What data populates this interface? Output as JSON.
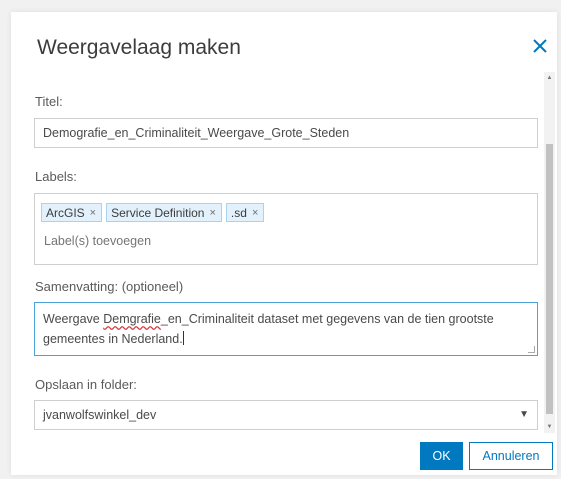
{
  "dialog": {
    "title": "Weergavelaag maken",
    "close_icon": "close-icon"
  },
  "fields": {
    "title_label": "Titel:",
    "title_value": "Demografie_en_Criminaliteit_Weergave_Grote_Steden",
    "labels_label": "Labels:",
    "tags": [
      "ArcGIS",
      "Service Definition",
      ".sd"
    ],
    "tag_remove_glyph": "×",
    "tags_placeholder": "Label(s) toevoegen",
    "summary_label": "Samenvatting: (optioneel)",
    "summary_before": "Weergave ",
    "summary_misspelled": "Demgrafie",
    "summary_after_line1": "_en_Criminaliteit dataset met gegevens van de tien grootste",
    "summary_line2": "gemeentes in Nederland.",
    "folder_label": "Opslaan in folder:",
    "folder_value": "jvanwolfswinkel_dev"
  },
  "buttons": {
    "ok": "OK",
    "cancel": "Annuleren"
  },
  "colors": {
    "accent": "#0079c1",
    "focus_border": "#4aa2d9",
    "tag_bg": "#e2f1fb"
  }
}
